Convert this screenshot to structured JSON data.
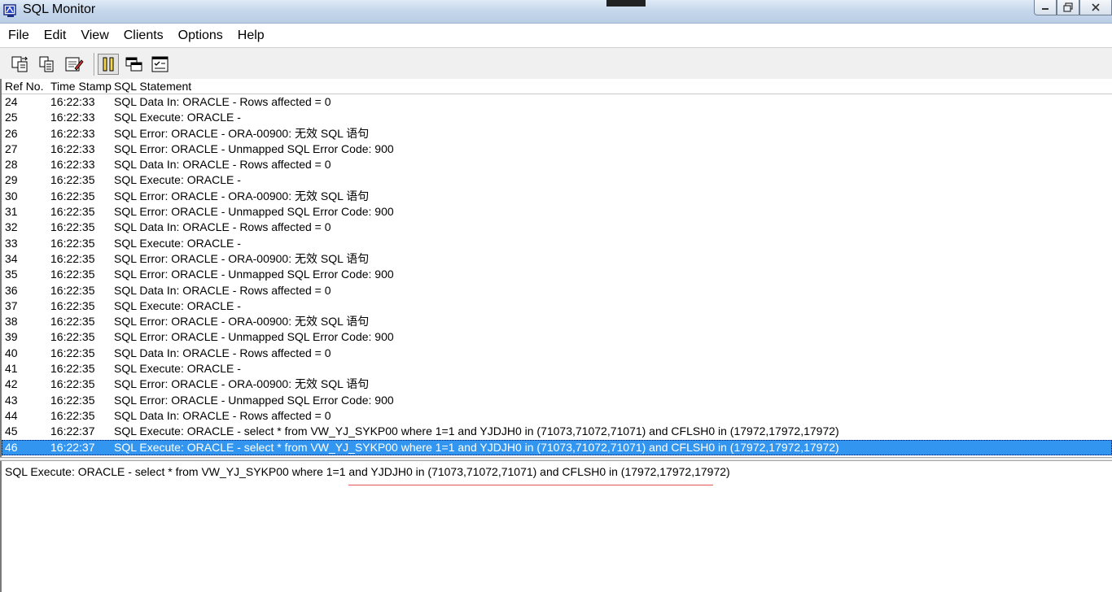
{
  "window": {
    "title": "SQL Monitor"
  },
  "menu": [
    "File",
    "Edit",
    "View",
    "Clients",
    "Options",
    "Help"
  ],
  "toolbar": {
    "buttons": [
      {
        "icon": "save-log-icon"
      },
      {
        "icon": "copy-icon"
      },
      {
        "icon": "edit-icon"
      },
      {
        "icon": "pause-icon",
        "pressed": true
      },
      {
        "icon": "windows-icon"
      },
      {
        "icon": "checklist-icon"
      }
    ]
  },
  "list": {
    "columns": [
      "Ref No.",
      "Time Stamp",
      "SQL Statement"
    ],
    "rows": [
      {
        "ref": "24",
        "time": "16:22:33",
        "sql": "SQL Data In: ORACLE - Rows affected = 0"
      },
      {
        "ref": "25",
        "time": "16:22:33",
        "sql": "SQL Execute: ORACLE -"
      },
      {
        "ref": "26",
        "time": "16:22:33",
        "sql": "SQL Error: ORACLE - ORA-00900: 无效 SQL 语句"
      },
      {
        "ref": "27",
        "time": "16:22:33",
        "sql": "SQL Error: ORACLE - Unmapped SQL Error Code: 900"
      },
      {
        "ref": "28",
        "time": "16:22:33",
        "sql": "SQL Data In: ORACLE - Rows affected = 0"
      },
      {
        "ref": "29",
        "time": "16:22:35",
        "sql": "SQL Execute: ORACLE -"
      },
      {
        "ref": "30",
        "time": "16:22:35",
        "sql": "SQL Error: ORACLE - ORA-00900: 无效 SQL 语句"
      },
      {
        "ref": "31",
        "time": "16:22:35",
        "sql": "SQL Error: ORACLE - Unmapped SQL Error Code: 900"
      },
      {
        "ref": "32",
        "time": "16:22:35",
        "sql": "SQL Data In: ORACLE - Rows affected = 0"
      },
      {
        "ref": "33",
        "time": "16:22:35",
        "sql": "SQL Execute: ORACLE -"
      },
      {
        "ref": "34",
        "time": "16:22:35",
        "sql": "SQL Error: ORACLE - ORA-00900: 无效 SQL 语句"
      },
      {
        "ref": "35",
        "time": "16:22:35",
        "sql": "SQL Error: ORACLE - Unmapped SQL Error Code: 900"
      },
      {
        "ref": "36",
        "time": "16:22:35",
        "sql": "SQL Data In: ORACLE - Rows affected = 0"
      },
      {
        "ref": "37",
        "time": "16:22:35",
        "sql": "SQL Execute: ORACLE -"
      },
      {
        "ref": "38",
        "time": "16:22:35",
        "sql": "SQL Error: ORACLE - ORA-00900: 无效 SQL 语句"
      },
      {
        "ref": "39",
        "time": "16:22:35",
        "sql": "SQL Error: ORACLE - Unmapped SQL Error Code: 900"
      },
      {
        "ref": "40",
        "time": "16:22:35",
        "sql": "SQL Data In: ORACLE - Rows affected = 0"
      },
      {
        "ref": "41",
        "time": "16:22:35",
        "sql": "SQL Execute: ORACLE -"
      },
      {
        "ref": "42",
        "time": "16:22:35",
        "sql": "SQL Error: ORACLE - ORA-00900: 无效 SQL 语句"
      },
      {
        "ref": "43",
        "time": "16:22:35",
        "sql": "SQL Error: ORACLE - Unmapped SQL Error Code: 900"
      },
      {
        "ref": "44",
        "time": "16:22:35",
        "sql": "SQL Data In: ORACLE - Rows affected = 0"
      },
      {
        "ref": "45",
        "time": "16:22:37",
        "sql": "SQL Execute: ORACLE - select * from VW_YJ_SYKP00 where 1=1 and YJDJH0 in (71073,71072,71071)  and CFLSH0 in (17972,17972,17972)"
      },
      {
        "ref": "46",
        "time": "16:22:37",
        "sql": "SQL Execute: ORACLE - select * from VW_YJ_SYKP00 where 1=1 and YJDJH0 in (71073,71072,71071)  and CFLSH0 in (17972,17972,17972)",
        "selected": true
      }
    ]
  },
  "detail": {
    "text": "SQL Execute: ORACLE - select * from VW_YJ_SYKP00 where 1=1 and YJDJH0 in (71073,71072,71071)  and CFLSH0 in (17972,17972,17972)"
  },
  "colors": {
    "selection": "#3296f0",
    "annotation_underline": "#e25656"
  }
}
